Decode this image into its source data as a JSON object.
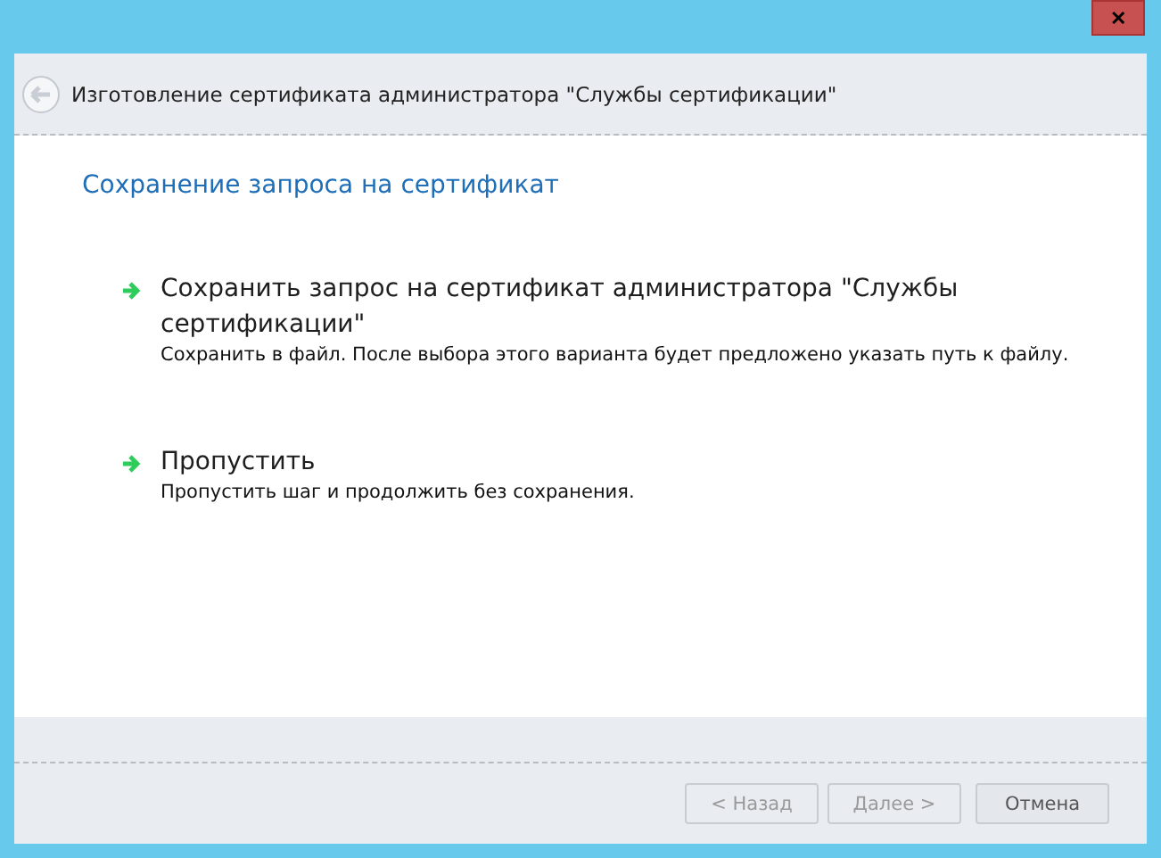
{
  "window": {
    "close": "✕"
  },
  "header": {
    "title": "Изготовление сертификата администратора \"Службы сертификации\""
  },
  "page_title": "Сохранение запроса на сертификат",
  "options": [
    {
      "label": "Сохранить запрос на сертификат администратора \"Службы сертификации\"",
      "description": "Сохранить в файл. После выбора этого варианта будет предложено указать путь к файлу."
    },
    {
      "label": "Пропустить",
      "description": "Пропустить шаг и продолжить без сохранения."
    }
  ],
  "buttons": [
    {
      "label": "< Назад",
      "disabled": true
    },
    {
      "label": "Далее >",
      "disabled": true
    },
    {
      "label": "Отмена",
      "disabled": false
    }
  ]
}
